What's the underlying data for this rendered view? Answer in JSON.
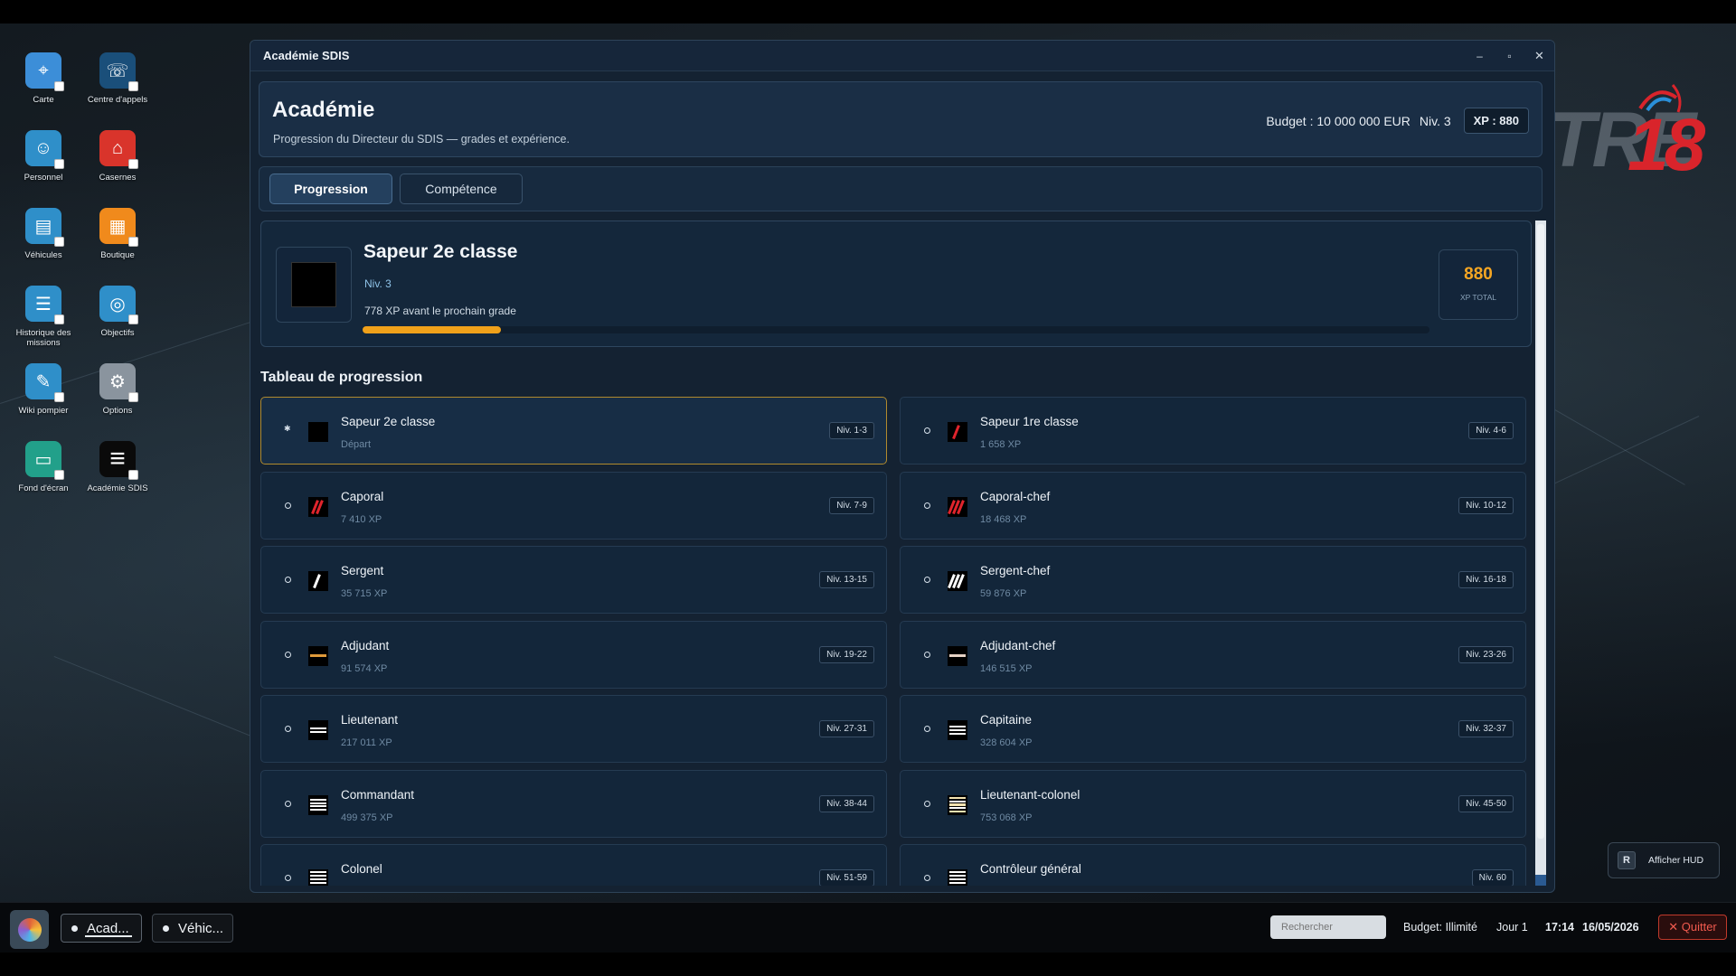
{
  "desktop": {
    "icons": [
      {
        "label": "Carte",
        "icon": "map-icon",
        "color": "#3c8ed8"
      },
      {
        "label": "Centre d'appels",
        "icon": "call-center-icon",
        "color": "#1a4f7a"
      },
      {
        "label": "Personnel",
        "icon": "personnel-icon",
        "color": "#2f8fc9"
      },
      {
        "label": "Casernes",
        "icon": "fire-station-icon",
        "color": "#d9342b"
      },
      {
        "label": "Véhicules",
        "icon": "vehicles-icon",
        "color": "#2f8fc9"
      },
      {
        "label": "Boutique",
        "icon": "shop-icon",
        "color": "#f08a1c"
      },
      {
        "label": "Historique des missions",
        "icon": "mission-history-icon",
        "color": "#2f8fc9"
      },
      {
        "label": "Objectifs",
        "icon": "objectives-icon",
        "color": "#2f8fc9"
      },
      {
        "label": "Wiki pompier",
        "icon": "wiki-icon",
        "color": "#2f8fc9"
      },
      {
        "label": "Options",
        "icon": "gear-icon",
        "color": "#8a949e"
      },
      {
        "label": "Fond d'écran",
        "icon": "wallpaper-icon",
        "color": "#22a08a"
      },
      {
        "label": "Académie SDIS",
        "icon": "academy-icon",
        "color": "#ffffff"
      }
    ],
    "logo": {
      "text": "TRE",
      "number": "18"
    },
    "hud_button": {
      "key": "R",
      "label": "Afficher HUD"
    }
  },
  "window": {
    "title": "Académie SDIS",
    "controls": {
      "minimize": "–",
      "maximize": "▫",
      "close": "✕"
    },
    "header": {
      "title": "Académie",
      "subtitle": "Progression du Directeur du SDIS — grades et expérience.",
      "budget": "Budget : 10 000 000 EUR",
      "level": "Niv. 3",
      "xp": "XP : 880"
    },
    "tabs": [
      {
        "label": "Progression",
        "active": true
      },
      {
        "label": "Compétence",
        "active": false
      }
    ],
    "current_grade": {
      "name": "Sapeur 2e classe",
      "level": "Niv. 3",
      "next": "778 XP avant le prochain grade",
      "progress": 0.13,
      "xp_total": "880",
      "xp_total_label": "XP TOTAL"
    },
    "table_title": "Tableau de progression",
    "grades": [
      {
        "name": "Sapeur 2e classe",
        "xp": "Départ",
        "niv": "Niv. 1-3",
        "current": true,
        "emblem": "none"
      },
      {
        "name": "Sapeur 1re classe",
        "xp": "1 658 XP",
        "niv": "Niv. 4-6",
        "current": false,
        "emblem": "red1"
      },
      {
        "name": "Caporal",
        "xp": "7 410 XP",
        "niv": "Niv. 7-9",
        "current": false,
        "emblem": "red2"
      },
      {
        "name": "Caporal-chef",
        "xp": "18 468 XP",
        "niv": "Niv. 10-12",
        "current": false,
        "emblem": "red3"
      },
      {
        "name": "Sergent",
        "xp": "35 715 XP",
        "niv": "Niv. 13-15",
        "current": false,
        "emblem": "white1"
      },
      {
        "name": "Sergent-chef",
        "xp": "59 876 XP",
        "niv": "Niv. 16-18",
        "current": false,
        "emblem": "white3"
      },
      {
        "name": "Adjudant",
        "xp": "91 574 XP",
        "niv": "Niv. 19-22",
        "current": false,
        "emblem": "gold-bar"
      },
      {
        "name": "Adjudant-chef",
        "xp": "146 515 XP",
        "niv": "Niv. 23-26",
        "current": false,
        "emblem": "silver-bar"
      },
      {
        "name": "Lieutenant",
        "xp": "217 011 XP",
        "niv": "Niv. 27-31",
        "current": false,
        "emblem": "bars2"
      },
      {
        "name": "Capitaine",
        "xp": "328 604 XP",
        "niv": "Niv. 32-37",
        "current": false,
        "emblem": "bars3"
      },
      {
        "name": "Commandant",
        "xp": "499 375 XP",
        "niv": "Niv. 38-44",
        "current": false,
        "emblem": "bars4"
      },
      {
        "name": "Lieutenant-colonel",
        "xp": "753 068 XP",
        "niv": "Niv. 45-50",
        "current": false,
        "emblem": "bars5-gold"
      },
      {
        "name": "Colonel",
        "xp": "",
        "niv": "Niv. 51-59",
        "current": false,
        "emblem": "bars5"
      },
      {
        "name": "Contrôleur général",
        "xp": "",
        "niv": "Niv. 60",
        "current": false,
        "emblem": "bars5"
      }
    ]
  },
  "taskbar": {
    "tasks": [
      {
        "label": "Acad...",
        "active": true
      },
      {
        "label": "Véhic...",
        "active": false
      }
    ],
    "search_placeholder": "Rechercher",
    "budget": "Budget: Illimité",
    "day": "Jour 1",
    "time": "17:14",
    "date": "16/05/2026",
    "quit": "✕ Quitter"
  },
  "colors": {
    "accent_orange": "#f0a11a",
    "window_bg": "#142232",
    "current_border": "#b08a2e"
  }
}
